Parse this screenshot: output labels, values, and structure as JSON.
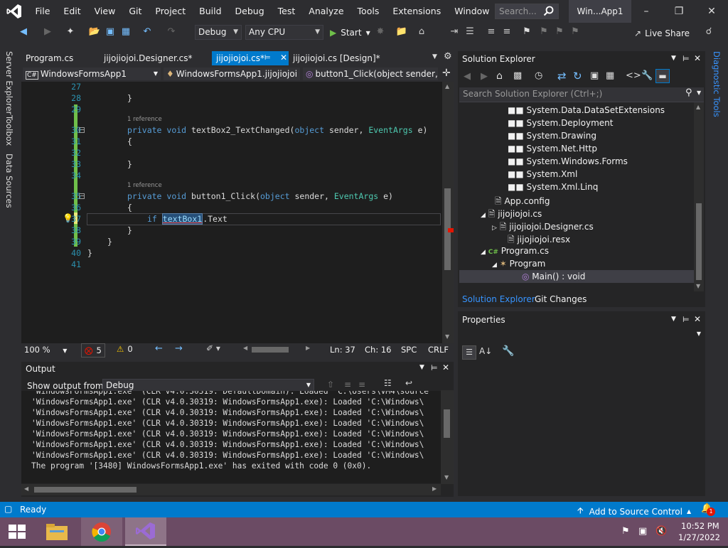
{
  "menu": [
    "File",
    "Edit",
    "View",
    "Git",
    "Project",
    "Build",
    "Debug",
    "Test",
    "Analyze",
    "Tools",
    "Extensions",
    "Window",
    "Help"
  ],
  "search": {
    "placeholder": "Search..."
  },
  "window_title": "Win...App1",
  "toolbar": {
    "config": "Debug",
    "platform": "Any CPU",
    "start": "Start",
    "live_share": "Live Share"
  },
  "left_strip": [
    "Server Explorer",
    "Toolbox",
    "Data Sources"
  ],
  "right_strip": "Diagnostic Tools",
  "doc_tabs": [
    "Program.cs",
    "jijojiojoi.Designer.cs*",
    "jijojiojoi.cs*",
    "jijojiojoi.cs [Design]*"
  ],
  "nav": {
    "project": "WindowsFormsApp1",
    "class": "WindowsFormsApp1.jijojiojoi",
    "member": "button1_Click(object sender, E"
  },
  "editor": {
    "line_numbers": [
      "27",
      "28",
      "29",
      "30",
      "31",
      "32",
      "33",
      "34",
      "35",
      "36",
      "37",
      "38",
      "39",
      "40",
      "41"
    ],
    "ref_label": "1 reference",
    "lines": {
      "l28": "}",
      "l30_kw1": "private",
      "l30_kw2": "void",
      "l30_name": "textBox2_TextChanged",
      "l30_p1": "(",
      "l30_kw3": "object",
      "l30_p2": " sender, ",
      "l30_ty": "EventArgs",
      "l30_p3": " e)",
      "l31": "{",
      "l33": "}",
      "l35_kw1": "private",
      "l35_kw2": "void",
      "l35_name": "button1_Click",
      "l35_p1": "(",
      "l35_kw3": "object",
      "l35_p2": " sender, ",
      "l35_ty": "EventArgs",
      "l35_p3": " e)",
      "l36": "{",
      "l37_kw": "if",
      "l37_sel": "textBox1",
      "l37_rest": ".Text",
      "l38": "}",
      "l39": "}",
      "l40": "}"
    }
  },
  "editor_status": {
    "zoom": "100 %",
    "errors": "5",
    "warnings": "0",
    "ln": "Ln: 37",
    "ch": "Ch: 16",
    "spc": "SPC",
    "crlf": "CRLF"
  },
  "output": {
    "title": "Output",
    "show_from_label": "Show output from:",
    "show_from_value": "Debug",
    "lines": [
      "'WindowsFormsApp1.exe' (CLR v4.0.30319: DefaultDomain): Loaded 'C:\\Users\\VM4\\source",
      "'WindowsFormsApp1.exe' (CLR v4.0.30319: WindowsFormsApp1.exe): Loaded 'C:\\Windows\\",
      "'WindowsFormsApp1.exe' (CLR v4.0.30319: WindowsFormsApp1.exe): Loaded 'C:\\Windows\\",
      "'WindowsFormsApp1.exe' (CLR v4.0.30319: WindowsFormsApp1.exe): Loaded 'C:\\Windows\\",
      "'WindowsFormsApp1.exe' (CLR v4.0.30319: WindowsFormsApp1.exe): Loaded 'C:\\Windows\\",
      "'WindowsFormsApp1.exe' (CLR v4.0.30319: WindowsFormsApp1.exe): Loaded 'C:\\Windows\\",
      "'WindowsFormsApp1.exe' (CLR v4.0.30319: WindowsFormsApp1.exe): Loaded 'C:\\Windows\\",
      "The program '[3480] WindowsFormsApp1.exe' has exited with code 0 (0x0)."
    ]
  },
  "solution_explorer": {
    "title": "Solution Explorer",
    "search_placeholder": "Search Solution Explorer (Ctrl+;)",
    "items": [
      "System.Data.DataSetExtensions",
      "System.Deployment",
      "System.Drawing",
      "System.Net.Http",
      "System.Windows.Forms",
      "System.Xml",
      "System.Xml.Linq",
      "App.config",
      "jijojiojoi.cs",
      "jijojiojoi.Designer.cs",
      "jijojiojoi.resx",
      "Program.cs",
      "Program",
      "Main() : void"
    ],
    "tabs": [
      "Solution Explorer",
      "Git Changes"
    ]
  },
  "properties": {
    "title": "Properties"
  },
  "statusbar": {
    "ready": "Ready",
    "source_control": "Add to Source Control",
    "notif": "1"
  },
  "taskbar": {
    "time": "10:52 PM",
    "date": "1/27/2022"
  }
}
